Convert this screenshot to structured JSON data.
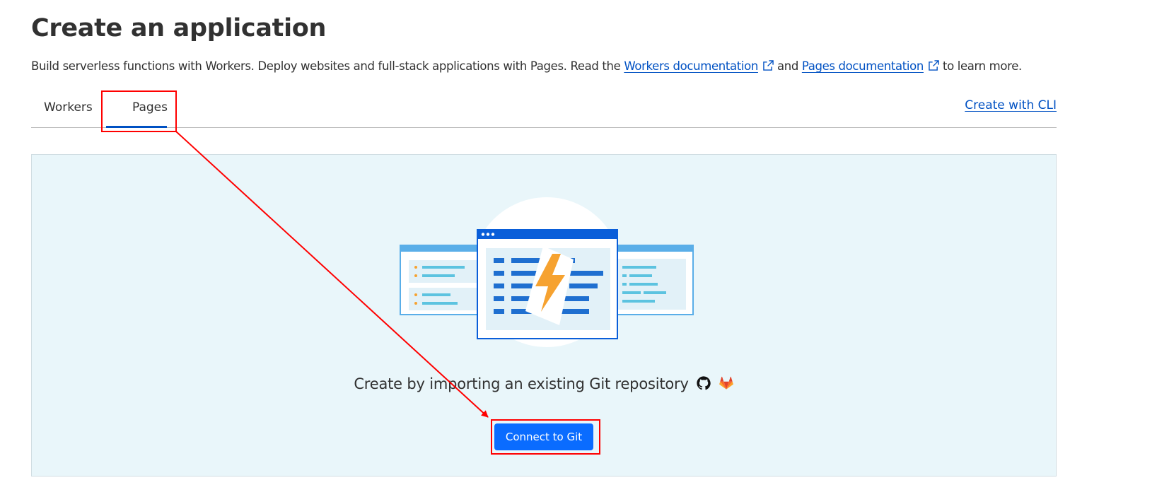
{
  "header": {
    "title": "Create an application"
  },
  "description": {
    "prefix": "Build serverless functions with Workers. Deploy websites and full-stack applications with Pages. Read the ",
    "workers_link": "Workers documentation",
    "middle": "and ",
    "pages_link": "Pages documentation",
    "suffix": "to learn more."
  },
  "tabs": [
    {
      "label": "Workers",
      "active": false
    },
    {
      "label": "Pages",
      "active": true
    }
  ],
  "cli_link": "Create with CLI",
  "panel": {
    "import_text": "Create by importing an existing Git repository",
    "icons": [
      "github-icon",
      "gitlab-icon"
    ],
    "connect_button": "Connect to Git"
  },
  "colors": {
    "accent": "#0051c3",
    "button": "#0a6cff",
    "panel_bg": "#e9f6fa",
    "annotation": "#ff0000",
    "lightning": "#f6a230"
  }
}
